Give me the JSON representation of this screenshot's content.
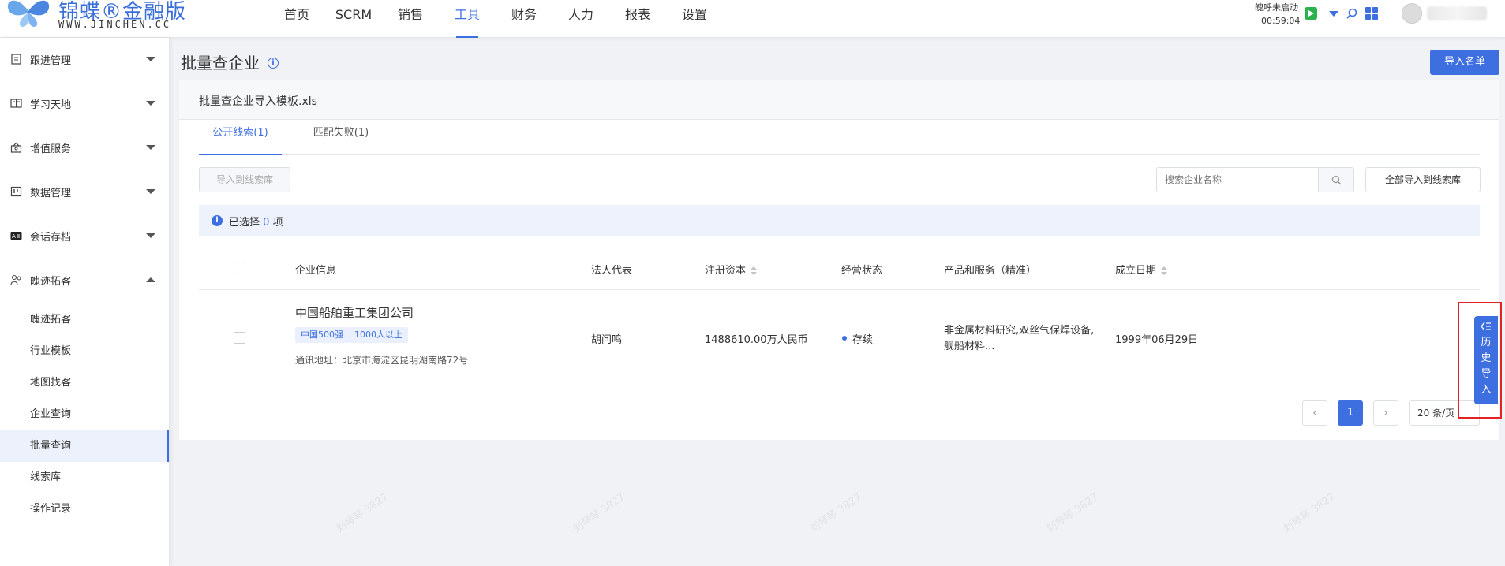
{
  "logo": {
    "name": "锦蝶®金融版",
    "url_text": "WWW.JINCHEN.CC"
  },
  "nav": [
    "首页",
    "SCRM",
    "销售",
    "工具",
    "财务",
    "人力",
    "报表",
    "设置"
  ],
  "nav_active": "工具",
  "call_status": {
    "label": "魄呼未启动",
    "time": "00:59:04"
  },
  "sidebar": {
    "groups": [
      {
        "label": "跟进管理",
        "icon": "clipboard-icon",
        "expanded": false
      },
      {
        "label": "学习天地",
        "icon": "book-icon",
        "expanded": false
      },
      {
        "label": "增值服务",
        "icon": "gift-icon",
        "expanded": false
      },
      {
        "label": "数据管理",
        "icon": "board-icon",
        "expanded": false
      },
      {
        "label": "会话存档",
        "icon": "chat-archive-icon",
        "expanded": false
      },
      {
        "label": "魄迹拓客",
        "icon": "people-icon",
        "expanded": true
      }
    ],
    "sub_items": [
      "魄迹拓客",
      "行业模板",
      "地图找客",
      "企业查询",
      "批量查询",
      "线索库",
      "操作记录"
    ],
    "active_sub": "批量查询"
  },
  "page": {
    "title": "批量查企业",
    "import_button": "导入名单",
    "file_name": "批量查企业导入模板.xls",
    "tabs": [
      "公开线索(1)",
      "匹配失败(1)"
    ],
    "active_tab": "公开线索(1)",
    "import_to_pool_button": "导入到线索库",
    "search_placeholder": "搜索企业名称",
    "import_all_button": "全部导入到线索库",
    "selection": {
      "prefix": "已选择",
      "count": "0",
      "suffix": "项"
    }
  },
  "table": {
    "columns": [
      "企业信息",
      "法人代表",
      "注册资本",
      "经营状态",
      "产品和服务（精准）",
      "成立日期"
    ],
    "rows": [
      {
        "company": "中国船舶重工集团公司",
        "tags": [
          "中国500强",
          "1000人以上"
        ],
        "address": "通讯地址：北京市海淀区昆明湖南路72号",
        "legal_rep": "胡问鸣",
        "capital": "1488610.00万人民币",
        "status": "存续",
        "products": "非金属材料研究,双丝气保焊设备,舰船材料...",
        "founded": "1999年06月29日"
      }
    ]
  },
  "pagination": {
    "current": "1",
    "page_size": "20 条/页"
  },
  "history_import": "历史导入",
  "watermark_text": "刘琴琴 3827",
  "colors": {
    "accent": "#3e6fe0",
    "highlight": "#e52222"
  }
}
